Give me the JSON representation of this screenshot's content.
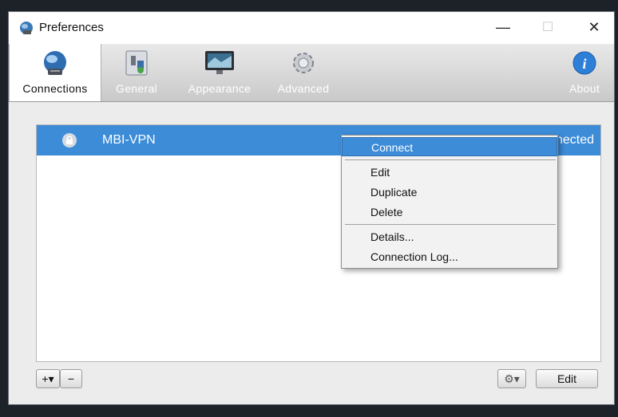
{
  "window": {
    "title": "Preferences",
    "minimize_glyph": "—",
    "maximize_glyph": "☐",
    "close_glyph": "✕"
  },
  "toolbar": {
    "tabs": [
      {
        "label": "Connections",
        "icon": "globe-connection-icon",
        "active": true
      },
      {
        "label": "General",
        "icon": "phone-switch-icon",
        "active": false
      },
      {
        "label": "Appearance",
        "icon": "monitor-icon",
        "active": false
      },
      {
        "label": "Advanced",
        "icon": "gear-icon",
        "active": false
      }
    ],
    "about": {
      "label": "About",
      "icon": "info-icon"
    }
  },
  "connections": {
    "rows": [
      {
        "name": "MBI-VPN",
        "status": "Connected",
        "selected": true
      }
    ]
  },
  "context_menu": {
    "items": [
      {
        "label": "Connect",
        "highlighted": true
      },
      {
        "label": "Edit"
      },
      {
        "label": "Duplicate"
      },
      {
        "label": "Delete"
      },
      {
        "label": "Details..."
      },
      {
        "label": "Connection Log..."
      }
    ]
  },
  "bottom_bar": {
    "add_label": "+▾",
    "remove_label": "−",
    "settings_label": "⚙▾",
    "edit_label": "Edit"
  },
  "colors": {
    "selection": "#3c8cd8",
    "toolbar_label": "#ffffff"
  }
}
